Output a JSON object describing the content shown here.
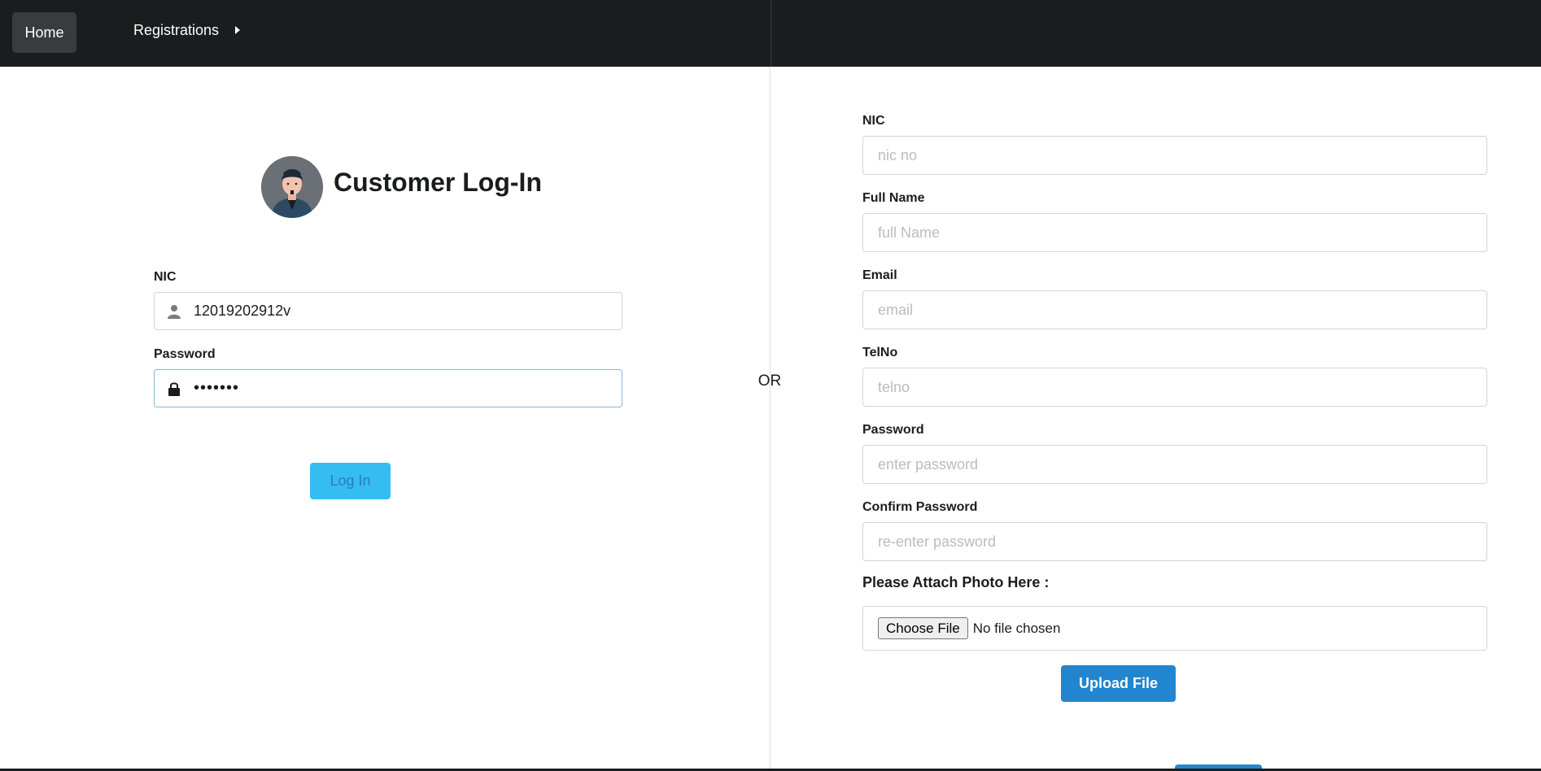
{
  "nav": {
    "home_label": "Home",
    "registrations_label": "Registrations"
  },
  "login": {
    "title": "Customer Log-In",
    "nic_label": "NIC",
    "nic_value": "12019202912v",
    "password_label": "Password",
    "password_value": "•••••••",
    "login_button": "Log In"
  },
  "divider_text": "OR",
  "register": {
    "nic_label": "NIC",
    "nic_placeholder": "nic no",
    "fullname_label": "Full Name",
    "fullname_placeholder": "full Name",
    "email_label": "Email",
    "email_placeholder": "email",
    "telno_label": "TelNo",
    "telno_placeholder": "telno",
    "password_label": "Password",
    "password_placeholder": "enter password",
    "confirm_label": "Confirm Password",
    "confirm_placeholder": "re-enter password",
    "attach_label": "Please Attach Photo Here :",
    "choose_file_button": "Choose File",
    "no_file_text": "No file chosen",
    "upload_button": "Upload File"
  },
  "colors": {
    "navbar": "#1b1c1d",
    "login_button": "#35bdf2",
    "upload_button": "#2185d0"
  },
  "icons": [
    "user-icon",
    "lock-icon",
    "caret-right-icon",
    "avatar-image"
  ]
}
